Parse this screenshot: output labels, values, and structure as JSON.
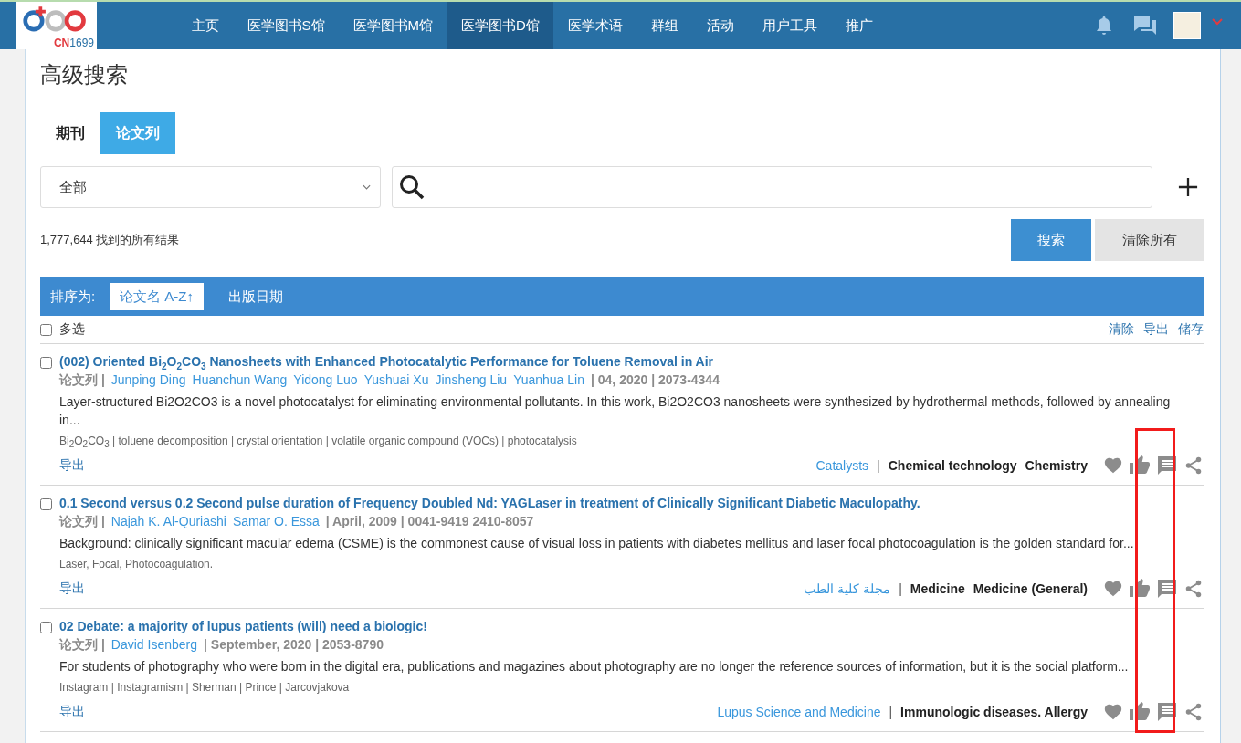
{
  "header": {
    "logo_text": "CN",
    "logo_number": "1699",
    "nav": [
      {
        "label": "主页",
        "selected": false
      },
      {
        "label": "医学图书S馆",
        "selected": false
      },
      {
        "label": "医学图书M馆",
        "selected": false
      },
      {
        "label": "医学图书D馆",
        "selected": true
      },
      {
        "label": "医学术语",
        "selected": false
      },
      {
        "label": "群组",
        "selected": false
      },
      {
        "label": "活动",
        "selected": false
      },
      {
        "label": "用户工具",
        "selected": false
      },
      {
        "label": "推广",
        "selected": false
      }
    ]
  },
  "page_title": "高级搜索",
  "tabs": [
    {
      "label": "期刊",
      "selected": false
    },
    {
      "label": "论文列",
      "selected": true
    }
  ],
  "search": {
    "scope": "全部",
    "search_button": "搜索",
    "clear_button": "清除所有"
  },
  "result_count": "1,777,644 找到的所有结果",
  "sort": {
    "label": "排序为:",
    "options": [
      {
        "label": "论文名 A-Z↑",
        "selected": true
      },
      {
        "label": "出版日期",
        "selected": false
      }
    ]
  },
  "toolbar": {
    "select_all": {
      "label": "多选",
      "checked": false
    },
    "actions": [
      "清除",
      "导出",
      "储存"
    ]
  },
  "results": [
    {
      "checked": false,
      "title": "(002) Oriented Bi$_{2}$O$_{2}$CO$_{3}$ Nanosheets with Enhanced Photocatalytic Performance for Toluene Removal in Air",
      "type": "论文列 |",
      "authors": [
        "Junping Ding",
        "Huanchun Wang",
        "Yidong Luo",
        "Yushuai Xu",
        "Jinsheng Liu",
        "Yuanhua Lin"
      ],
      "publication": "| 04, 2020 | 2073-4344",
      "abstract": "Layer-structured Bi2O2CO3 is a novel photocatalyst for eliminating environmental pollutants. In this work, Bi2O2CO3 nanosheets were synthesized by hydrothermal methods, followed by annealing in...",
      "keywords": "Bi$_{2}$O$_{2}$CO$_{3}$ | toluene decomposition | crystal orientation | volatile organic compound (VOCs) | photocatalysis",
      "export": "导出",
      "journal": "Catalysts",
      "separator": "|",
      "subjects": [
        "Chemical technology",
        "Chemistry"
      ]
    },
    {
      "checked": false,
      "title": "0.1 Second versus 0.2 Second pulse duration of Frequency Doubled Nd: YAGLaser in treatment of Clinically Significant Diabetic Maculopathy.",
      "type": "论文列 |",
      "authors": [
        "Najah K. Al-Quriashi",
        "Samar O. Essa"
      ],
      "publication": "| April, 2009 | 0041-9419 2410-8057",
      "abstract": "Background: clinically significant macular edema (CSME) is the commonest cause of visual loss in patients with diabetes mellitus and laser focal photocoagulation is the golden standard for...",
      "keywords": "Laser, Focal, Photocoagulation.",
      "export": "导出",
      "journal": "مجلة كلية الطب",
      "separator": "|",
      "subjects": [
        "Medicine",
        "Medicine (General)"
      ]
    },
    {
      "checked": false,
      "title": "02 Debate: a majority of lupus patients (will) need a biologic!",
      "type": "论文列 |",
      "authors": [
        "David Isenberg"
      ],
      "publication": "| September, 2020 | 2053-8790",
      "abstract": "For students of photography who were born in the digital era, publications and magazines about photography are no longer the reference sources of information, but it is the social platform...",
      "keywords": "Instagram | Instagramism | Sherman | Prince | Jarcovjakova",
      "export": "导出",
      "journal": "Lupus Science and Medicine",
      "separator": "|",
      "subjects": [
        "Immunologic diseases. Allergy"
      ]
    }
  ]
}
